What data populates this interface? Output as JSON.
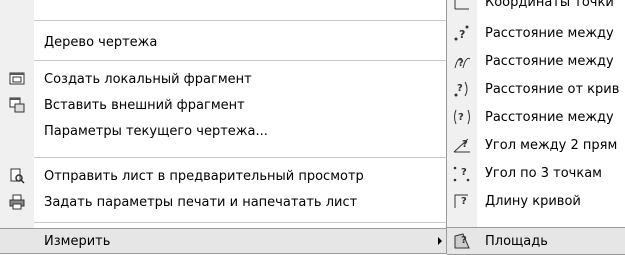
{
  "main_menu": {
    "items": [
      {
        "label": "Дерево чертежа",
        "icon": "none"
      },
      {
        "label": "Создать локальный фрагмент",
        "icon": "local-fragment-icon"
      },
      {
        "label": "Вставить внешний фрагмент",
        "icon": "external-fragment-icon"
      },
      {
        "label": "Параметры текущего чертежа...",
        "icon": "none"
      },
      {
        "label": "Отправить лист в предварительный просмотр",
        "icon": "preview-icon"
      },
      {
        "label": "Задать параметры печати и напечатать лист",
        "icon": "print-icon"
      },
      {
        "label": "Измерить",
        "icon": "none"
      }
    ]
  },
  "submenu": {
    "items": [
      {
        "label": "Координаты точки",
        "icon": "point-coordinates-icon"
      },
      {
        "label": "Расстояние между",
        "icon": "distance-points-icon"
      },
      {
        "label": "Расстояние между",
        "icon": "distance-point-curve-icon"
      },
      {
        "label": "Расстояние от крив",
        "icon": "distance-from-curve-icon"
      },
      {
        "label": "Расстояние между",
        "icon": "distance-curves-icon"
      },
      {
        "label": "Угол между 2 прям",
        "icon": "angle-two-lines-icon"
      },
      {
        "label": "Угол по 3 точкам",
        "icon": "angle-three-points-icon"
      },
      {
        "label": "Длину кривой",
        "icon": "curve-length-icon"
      },
      {
        "label": "Площадь",
        "icon": "area-icon"
      }
    ]
  }
}
